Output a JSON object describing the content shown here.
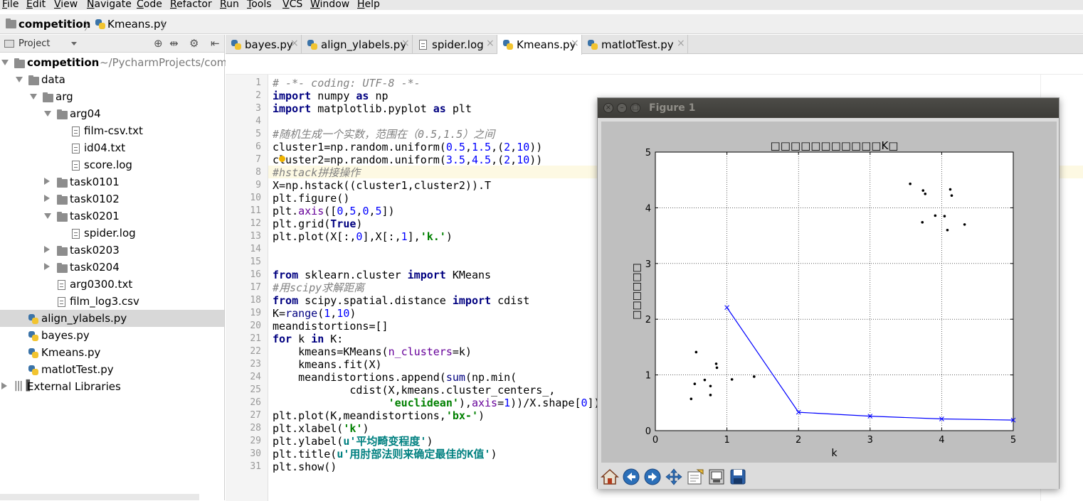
{
  "menu": [
    "File",
    "Edit",
    "View",
    "Navigate",
    "Code",
    "Refactor",
    "Run",
    "Tools",
    "VCS",
    "Window",
    "Help"
  ],
  "breadcrumb": {
    "project": "competition",
    "file": "Kmeans.py"
  },
  "project_panel": {
    "title": "Project",
    "tree": [
      {
        "label": "competition",
        "extra": "~/PycharmProjects/compe",
        "kind": "folder",
        "expanded": true
      },
      {
        "label": "data",
        "kind": "folder",
        "expanded": true
      },
      {
        "label": "arg",
        "kind": "folder",
        "expanded": true
      },
      {
        "label": "arg04",
        "kind": "folder",
        "expanded": true
      },
      {
        "label": "film-csv.txt",
        "kind": "file"
      },
      {
        "label": "id04.txt",
        "kind": "file"
      },
      {
        "label": "score.log",
        "kind": "file"
      },
      {
        "label": "task0101",
        "kind": "folder",
        "expanded": false
      },
      {
        "label": "task0102",
        "kind": "folder",
        "expanded": false
      },
      {
        "label": "task0201",
        "kind": "folder",
        "expanded": true
      },
      {
        "label": "spider.log",
        "kind": "file"
      },
      {
        "label": "task0203",
        "kind": "folder",
        "expanded": false
      },
      {
        "label": "task0204",
        "kind": "folder",
        "expanded": false
      },
      {
        "label": "arg0300.txt",
        "kind": "file"
      },
      {
        "label": "film_log3.csv",
        "kind": "file"
      },
      {
        "label": "align_ylabels.py",
        "kind": "py",
        "selected": true
      },
      {
        "label": "bayes.py",
        "kind": "py"
      },
      {
        "label": "Kmeans.py",
        "kind": "py"
      },
      {
        "label": "matlotTest.py",
        "kind": "py"
      },
      {
        "label": "External Libraries",
        "kind": "lib",
        "expanded": false
      }
    ]
  },
  "tabs": [
    {
      "label": "bayes.py",
      "kind": "py",
      "active": false
    },
    {
      "label": "align_ylabels.py",
      "kind": "py",
      "active": false
    },
    {
      "label": "spider.log",
      "kind": "file",
      "active": false
    },
    {
      "label": "Kmeans.py",
      "kind": "py",
      "active": true
    },
    {
      "label": "matlotTest.py",
      "kind": "py",
      "active": false
    }
  ],
  "code_lines": [
    "# -*- coding: UTF-8 -*-",
    "import numpy as np",
    "import matplotlib.pyplot as plt",
    "",
    "#随机生成一个实数，范围在（0.5,1.5）之间",
    "cluster1=np.random.uniform(0.5,1.5,(2,10))",
    "cluster2=np.random.uniform(3.5,4.5,(2,10))",
    "#hstack拼接操作",
    "X=np.hstack((cluster1,cluster2)).T",
    "plt.figure()",
    "plt.axis([0,5,0,5])",
    "plt.grid(True)",
    "plt.plot(X[:,0],X[:,1],'k.')",
    "",
    "",
    "from sklearn.cluster import KMeans",
    "#用scipy求解距离",
    "from scipy.spatial.distance import cdist",
    "K=range(1,10)",
    "meandistortions=[]",
    "for k in K:",
    "    kmeans=KMeans(n_clusters=k)",
    "    kmeans.fit(X)",
    "    meandistortions.append(sum(np.min(",
    "            cdist(X,kmeans.cluster_centers_,",
    "                  'euclidean'),axis=1))/X.shape[0])",
    "plt.plot(K,meandistortions,'bx-')",
    "plt.xlabel('k')",
    "plt.ylabel(u'平均畸变程度')",
    "plt.title(u'用肘部法则来确定最佳的K值')",
    "plt.show()"
  ],
  "figure": {
    "window_title": "Figure 1",
    "toolbar": [
      "home-icon",
      "back-icon",
      "forward-icon",
      "pan-icon",
      "zoom-icon",
      "configure-subplots-icon",
      "save-icon"
    ]
  },
  "chart_data": {
    "type": "line",
    "title": "□□□□□□□□□□□K□",
    "xlabel": "k",
    "ylabel": "□□□□□□",
    "xlim": [
      0,
      5
    ],
    "ylim": [
      0,
      5
    ],
    "xticks": [
      "0",
      "1",
      "2",
      "3",
      "4",
      "5"
    ],
    "yticks": [
      "0",
      "1",
      "2",
      "3",
      "4",
      "5"
    ],
    "grid": true,
    "scatter_points": [
      [
        0.5,
        0.57
      ],
      [
        0.55,
        0.84
      ],
      [
        0.57,
        1.41
      ],
      [
        0.69,
        0.91
      ],
      [
        0.77,
        0.8
      ],
      [
        0.77,
        0.64
      ],
      [
        0.85,
        1.2
      ],
      [
        0.86,
        1.13
      ],
      [
        1.07,
        0.92
      ],
      [
        1.38,
        0.97
      ],
      [
        3.56,
        4.43
      ],
      [
        3.74,
        4.31
      ],
      [
        3.77,
        4.25
      ],
      [
        3.73,
        3.74
      ],
      [
        3.91,
        3.86
      ],
      [
        4.04,
        3.85
      ],
      [
        4.08,
        3.6
      ],
      [
        4.12,
        4.33
      ],
      [
        4.14,
        4.22
      ],
      [
        4.32,
        3.7
      ]
    ],
    "series": [
      {
        "x": [
          1,
          2,
          3,
          4,
          5
        ],
        "values": [
          2.21,
          0.33,
          0.26,
          0.21,
          0.19
        ],
        "color": "#0000ff",
        "marker": "x"
      }
    ]
  }
}
